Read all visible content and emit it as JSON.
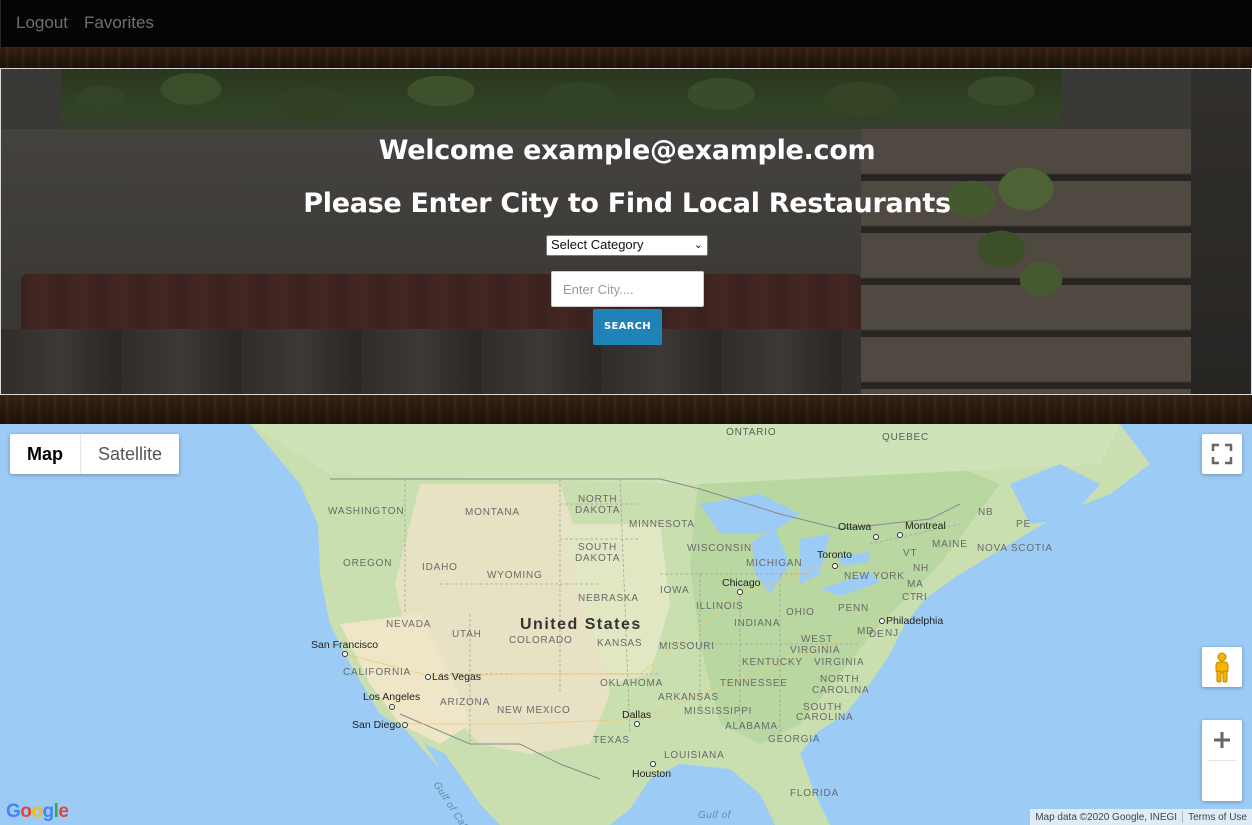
{
  "nav": {
    "logout": "Logout",
    "favorites": "Favorites"
  },
  "hero": {
    "welcome": "Welcome example@example.com",
    "prompt": "Please Enter City to Find Local Restaurants",
    "category_selected": "Select Category",
    "city_placeholder": "Enter City....",
    "search_label": "SEARCH"
  },
  "map": {
    "map_type": {
      "map": "Map",
      "satellite": "Satellite",
      "active": "Map"
    },
    "country_label": "United States",
    "region_labels": {
      "ontario": "ONTARIO",
      "quebec": "QUEBEC",
      "washington": "WASHINGTON",
      "montana": "MONTANA",
      "north_dakota_1": "NORTH",
      "north_dakota_2": "DAKOTA",
      "minnesota": "MINNESOTA",
      "south_dakota_1": "SOUTH",
      "south_dakota_2": "DAKOTA",
      "wisconsin": "WISCONSIN",
      "michigan": "MICHIGAN",
      "oregon": "OREGON",
      "idaho": "IDAHO",
      "wyoming": "WYOMING",
      "iowa": "IOWA",
      "nebraska": "NEBRASKA",
      "illinois": "ILLINOIS",
      "indiana": "INDIANA",
      "ohio": "OHIO",
      "nevada": "NEVADA",
      "utah": "UTAH",
      "colorado": "COLORADO",
      "kansas": "KANSAS",
      "missouri": "MISSOURI",
      "california": "CALIFORNIA",
      "arizona": "ARIZONA",
      "oklahoma": "OKLAHOMA",
      "arkansas": "ARKANSAS",
      "new_mexico": "NEW MEXICO",
      "texas": "TEXAS",
      "mississippi": "MISSISSIPPI",
      "alabama": "ALABAMA",
      "georgia": "GEORGIA",
      "louisiana": "LOUISIANA",
      "florida": "FLORIDA",
      "tennessee": "TENNESSEE",
      "kentucky": "KENTUCKY",
      "west_virginia_1": "WEST",
      "west_virginia_2": "VIRGINIA",
      "virginia": "VIRGINIA",
      "north_carolina_1": "NORTH",
      "north_carolina_2": "CAROLINA",
      "south_carolina_1": "SOUTH",
      "south_carolina_2": "CAROLINA",
      "pennsylvania": "PENN",
      "new_york": "NEW YORK",
      "vermont": "VT",
      "new_hampshire": "NH",
      "maine": "MAINE",
      "massachusetts": "MA",
      "connecticut": "CT",
      "rhode_island": "RI",
      "new_jersey": "NJ",
      "maryland": "MD",
      "delaware": "DE",
      "new_brunswick": "NB",
      "pei": "PE",
      "nova_scotia": "NOVA SCOTIA"
    },
    "cities": {
      "ottawa": "Ottawa",
      "montreal": "Montreal",
      "toronto": "Toronto",
      "chicago": "Chicago",
      "philadelphia": "Philadelphia",
      "san_francisco": "San Francisco",
      "las_vegas": "Las Vegas",
      "los_angeles": "Los Angeles",
      "san_diego": "San Diego",
      "dallas": "Dallas",
      "houston": "Houston"
    },
    "water_labels": {
      "gulf_of_california": "Gulf of California",
      "gulf_of_mexico": "Gulf of"
    },
    "attribution": "Map data ©2020 Google, INEGI",
    "terms": "Terms of Use",
    "logo": [
      "G",
      "o",
      "o",
      "g",
      "l",
      "e"
    ],
    "icons": {
      "fullscreen": "fullscreen-icon",
      "pegman": "pegman-icon",
      "zoom_in": "plus-icon",
      "zoom_out": "minus-icon"
    },
    "colors": {
      "water": "#9ccbf5",
      "land": "#c9dfb0",
      "desert": "#efe6c8"
    }
  }
}
